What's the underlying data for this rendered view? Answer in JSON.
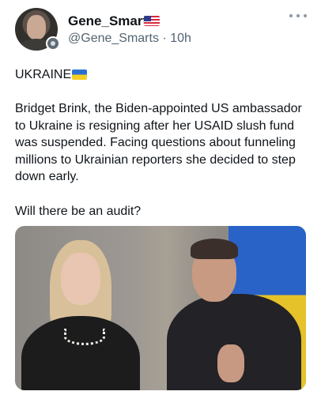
{
  "tweet": {
    "username": "Gene_Smarts",
    "handle": "@Gene_Smarts",
    "time": "10h",
    "headline": "UKRAINE",
    "body": "Bridget Brink, the Biden-appointed US ambassador to Ukraine is resigning after her USAID slush fund was suspended. Facing questions about funneling millions to Ukrainian reporters she decided to step down early.",
    "question": "Will there be an audit?"
  },
  "icons": {
    "username_flag": "us-flag-icon",
    "headline_flag": "ukraine-flag-icon",
    "more": "more-options-icon",
    "badge": "verified-badge-icon"
  }
}
